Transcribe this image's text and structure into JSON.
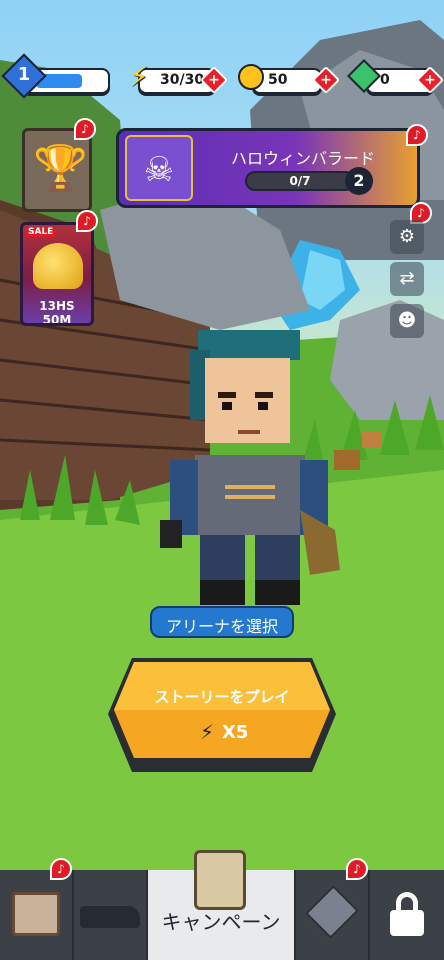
{
  "hud": {
    "level": "1",
    "energy": "30/30",
    "coins": "50",
    "gems": "0"
  },
  "event": {
    "title": "ハロウィンバラード",
    "progress": "0/7",
    "progress_fraction": 0,
    "badge_count": "2"
  },
  "shop": {
    "sale_label": "SALE",
    "timer": "13HS 50M"
  },
  "arena_button": "アリーナを選択",
  "play": {
    "label": "ストーリーをプレイ",
    "cost": "X5"
  },
  "nav": {
    "active_label": "キャンペーン"
  },
  "colors": {
    "accent_orange": "#f5a623",
    "event_purple": "#5a2fb5",
    "alert_red": "#e01b26",
    "nav_bg": "#3c4047"
  }
}
